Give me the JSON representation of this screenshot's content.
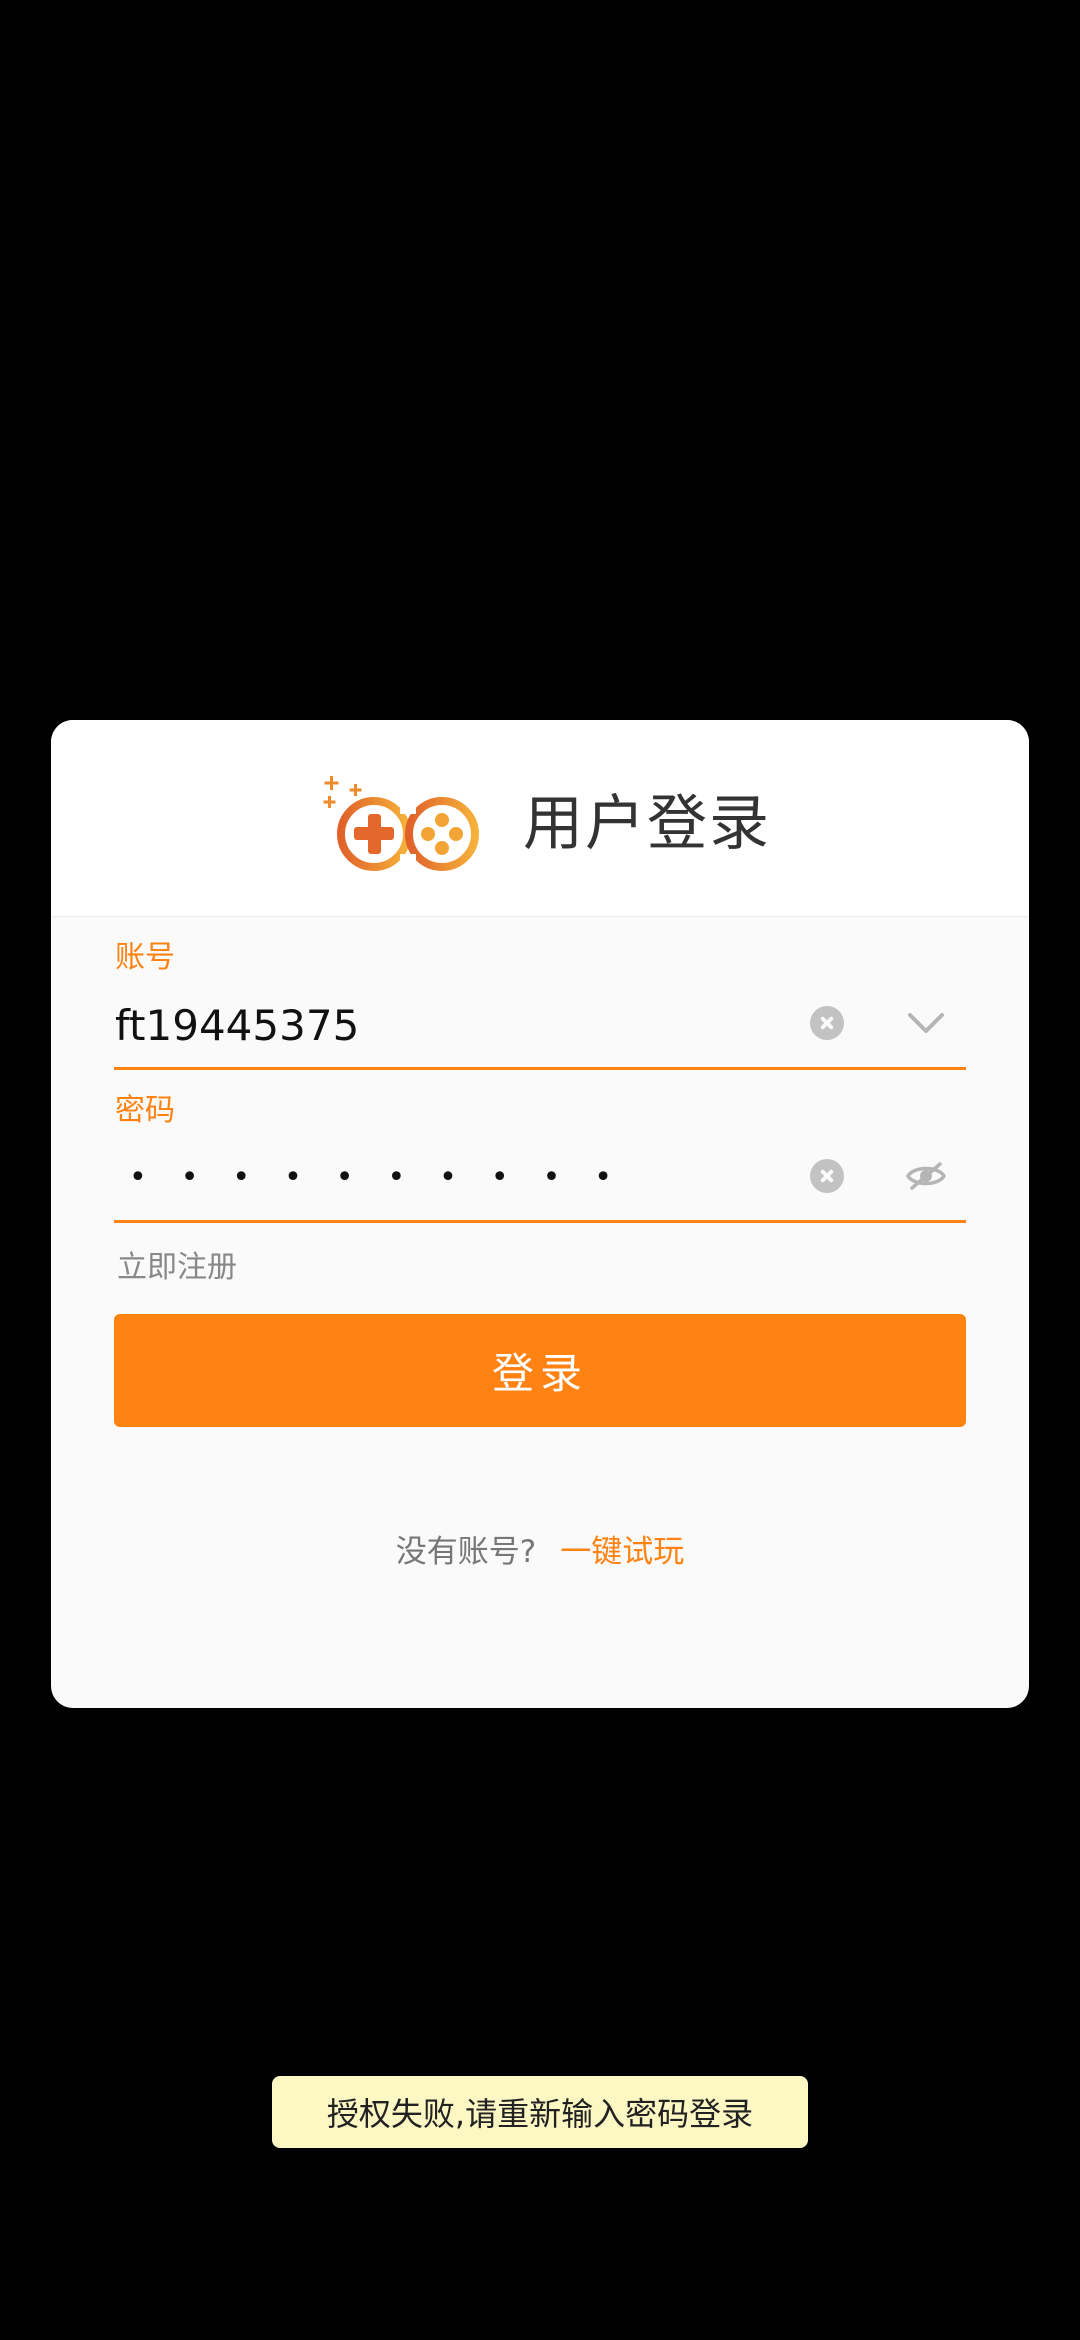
{
  "dialog": {
    "title": "用户登录",
    "account": {
      "label": "账号",
      "value": "ft19445375"
    },
    "password": {
      "label": "密码",
      "masked_value": "••••••••••"
    },
    "register_link": "立即注册",
    "login_button": "登录",
    "footer": {
      "no_account_text": "没有账号?",
      "quick_play_link": "一键试玩"
    }
  },
  "toast": {
    "message": "授权失败,请重新输入密码登录"
  },
  "icons": {
    "logo": "gamepad-logo-icon",
    "account_clear": "clear-icon",
    "account_dropdown": "chevron-down-icon",
    "password_clear": "clear-icon",
    "password_visibility": "eye-off-icon"
  },
  "colors": {
    "accent": "#ff8213",
    "logo_gradient_start": "#e0622a",
    "logo_gradient_end": "#f5b13a",
    "toast_background": "#fdf7c4"
  }
}
